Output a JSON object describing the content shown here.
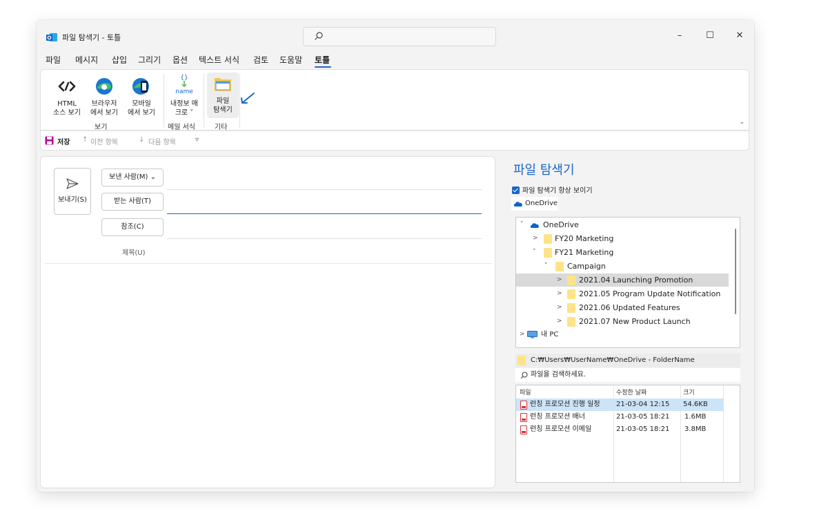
{
  "window": {
    "title": "파일 탐색기 - 토틀",
    "controls": {
      "minimize": "–",
      "maximize": "☐",
      "close": "✕"
    }
  },
  "menu": {
    "items": [
      "파일",
      "메시지",
      "삽입",
      "그리기",
      "옵션",
      "텍스트 서식",
      "검토",
      "도움말",
      "토틀"
    ],
    "active": "토틀"
  },
  "ribbon": {
    "buttons": {
      "html": {
        "line1": "HTML",
        "line2": "소스 보기"
      },
      "browser": {
        "line1": "브라우저",
        "line2": "에서 보기"
      },
      "mobile": {
        "line1": "모바일",
        "line2": "에서 보기"
      },
      "macro": {
        "line1": "내정보 매",
        "line2": "크로 ˅",
        "icon_text": "name"
      },
      "explorer": {
        "line1": "파일",
        "line2": "탐색기"
      }
    },
    "groups": {
      "view": "보기",
      "mail_format": "메일 서식",
      "etc": "기타"
    },
    "collapse_glyph": "⌄"
  },
  "qat": {
    "save": "저장",
    "prev": "이전 항목",
    "next": "다음 항목"
  },
  "compose": {
    "send": "보내기(S)",
    "from": "보낸 사람(M) ⌄",
    "to": "받는 사람(T)",
    "cc": "참조(C)",
    "subject": "제목(U)"
  },
  "pane": {
    "title": "파일 탐색기",
    "always_show": "파일 탐색기 항상 보이기",
    "tab": "OneDrive",
    "tree": {
      "root": "OneDrive",
      "fy20": "FY20 Marketing",
      "fy21": "FY21 Marketing",
      "campaign": "Campaign",
      "items": [
        "2021.04 Launching Promotion",
        "2021.05 Program Update Notification",
        "2021.06 Updated Features",
        "2021.07 New Product Launch"
      ],
      "my_pc": "내 PC"
    },
    "path": "C:₩Users₩UserName₩OneDrive - FolderName",
    "search_placeholder": "파일을 검색하세요.",
    "columns": {
      "name": "파일",
      "modified": "수정한 날짜",
      "size": "크기"
    },
    "files": [
      {
        "name": "런칭 프로모션 진행 일정",
        "modified": "21-03-04 12:15",
        "size": "54.6KB"
      },
      {
        "name": "런칭 프로모션 배너",
        "modified": "21-03-05 18:21",
        "size": "1.6MB"
      },
      {
        "name": "런칭 프로모션 이메일",
        "modified": "21-03-05 18:21",
        "size": "3.8MB"
      }
    ]
  },
  "colors": {
    "accent": "#1a66c9",
    "folder": "#fde38a",
    "selection": "#cce4f7",
    "pdf": "#d13438"
  }
}
